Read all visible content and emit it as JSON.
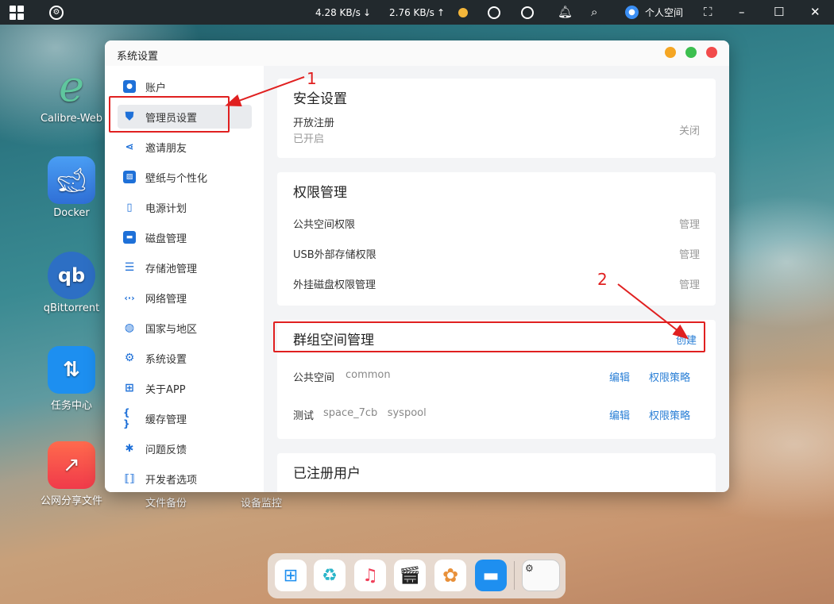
{
  "taskbar": {
    "download_speed": "4.28 KB/s",
    "upload_speed": "2.76 KB/s",
    "user_label": "个人空间"
  },
  "desktop": {
    "apps": [
      {
        "label": "Calibre-Web",
        "icon": "calibre-web-icon"
      },
      {
        "label": "Docker",
        "icon": "docker-whale-icon"
      },
      {
        "label": "qBittorrent",
        "icon": "qbittorrent-icon"
      },
      {
        "label": "任务中心",
        "icon": "task-center-icon"
      },
      {
        "label": "公网分享文件",
        "icon": "share-files-icon"
      }
    ],
    "bottom_labels": [
      "文件备份",
      "设备监控"
    ]
  },
  "window": {
    "title": "系统设置",
    "sidebar": [
      {
        "label": "账户",
        "icon": "account-icon"
      },
      {
        "label": "管理员设置",
        "icon": "admin-shield-icon"
      },
      {
        "label": "邀请朋友",
        "icon": "share-icon"
      },
      {
        "label": "壁纸与个性化",
        "icon": "wallpaper-icon"
      },
      {
        "label": "电源计划",
        "icon": "power-icon"
      },
      {
        "label": "磁盘管理",
        "icon": "disk-icon"
      },
      {
        "label": "存储池管理",
        "icon": "storage-pool-icon"
      },
      {
        "label": "网络管理",
        "icon": "network-icon"
      },
      {
        "label": "国家与地区",
        "icon": "globe-icon"
      },
      {
        "label": "系统设置",
        "icon": "gear-icon"
      },
      {
        "label": "关于APP",
        "icon": "windows-icon"
      },
      {
        "label": "缓存管理",
        "icon": "braces-icon"
      },
      {
        "label": "问题反馈",
        "icon": "bug-icon"
      },
      {
        "label": "开发者选项",
        "icon": "developer-icon"
      }
    ],
    "security": {
      "title": "安全设置",
      "open_register_label": "开放注册",
      "open_register_status": "已开启",
      "open_register_action": "关闭"
    },
    "permissions": {
      "title": "权限管理",
      "rows": [
        {
          "label": "公共空间权限",
          "action": "管理"
        },
        {
          "label": "USB外部存储权限",
          "action": "管理"
        },
        {
          "label": "外挂磁盘权限管理",
          "action": "管理"
        }
      ]
    },
    "group_space": {
      "title": "群组空间管理",
      "create_label": "创建",
      "rows": [
        {
          "name": "公共空间",
          "details": "common",
          "edit": "编辑",
          "policy": "权限策略"
        },
        {
          "name": "测试",
          "details": "space_7cb   syspool",
          "edit": "编辑",
          "policy": "权限策略"
        }
      ]
    },
    "registered_users": {
      "title": "已注册用户"
    }
  },
  "annotations": {
    "step1": "1",
    "step2": "2",
    "color": "#e02020"
  },
  "dock": {
    "items": [
      "app-grid-icon",
      "recycle-bin-icon",
      "music-icon",
      "video-clapper-icon",
      "photos-icon",
      "folder-icon",
      "settings-window-thumbnail"
    ]
  }
}
